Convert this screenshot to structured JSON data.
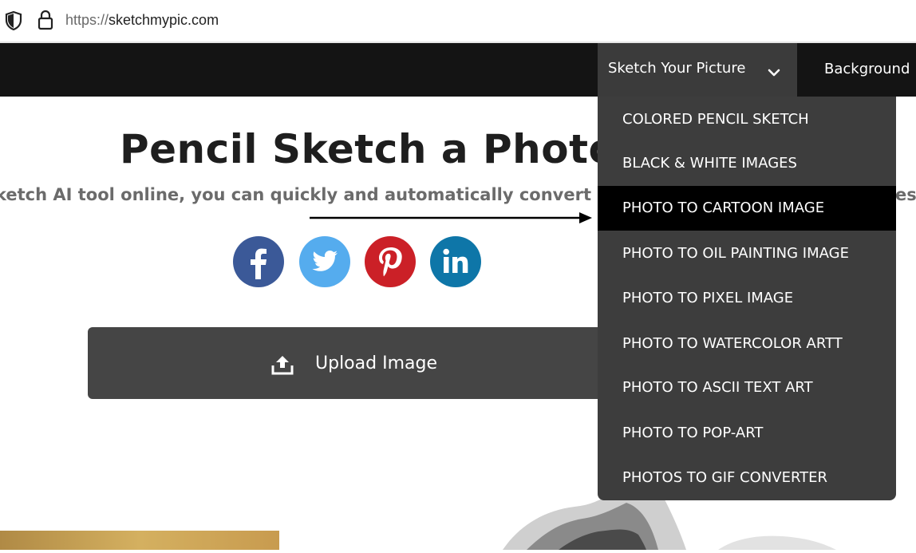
{
  "browser": {
    "url_protocol": "https://",
    "url_host": "sketchmypic.com"
  },
  "nav": {
    "sketch_label": "Sketch Your Picture",
    "background_label": "Background"
  },
  "hero": {
    "title": "Pencil Sketch a Photo",
    "subtitle": "ketch AI tool online, you can quickly and automatically convert",
    "subtitle_end": "es."
  },
  "social": [
    "facebook-icon",
    "twitter-icon",
    "pinterest-icon",
    "linkedin-icon"
  ],
  "upload": {
    "label": "Upload Image"
  },
  "dropdown": {
    "items": [
      "COLORED PENCIL SKETCH",
      "BLACK & WHITE IMAGES",
      "PHOTO TO CARTOON IMAGE",
      "PHOTO TO OIL PAINTING IMAGE",
      "PHOTO TO PIXEL IMAGE",
      "PHOTO TO WATERCOLOR ARTT",
      "PHOTO TO ASCII TEXT ART",
      "PHOTO TO POP-ART",
      "PHOTOS TO GIF CONVERTER"
    ],
    "active_index": 2
  },
  "colors": {
    "facebook": "#3b5998",
    "twitter": "#55acee",
    "pinterest": "#cb2027",
    "linkedin": "#0e76a8"
  }
}
